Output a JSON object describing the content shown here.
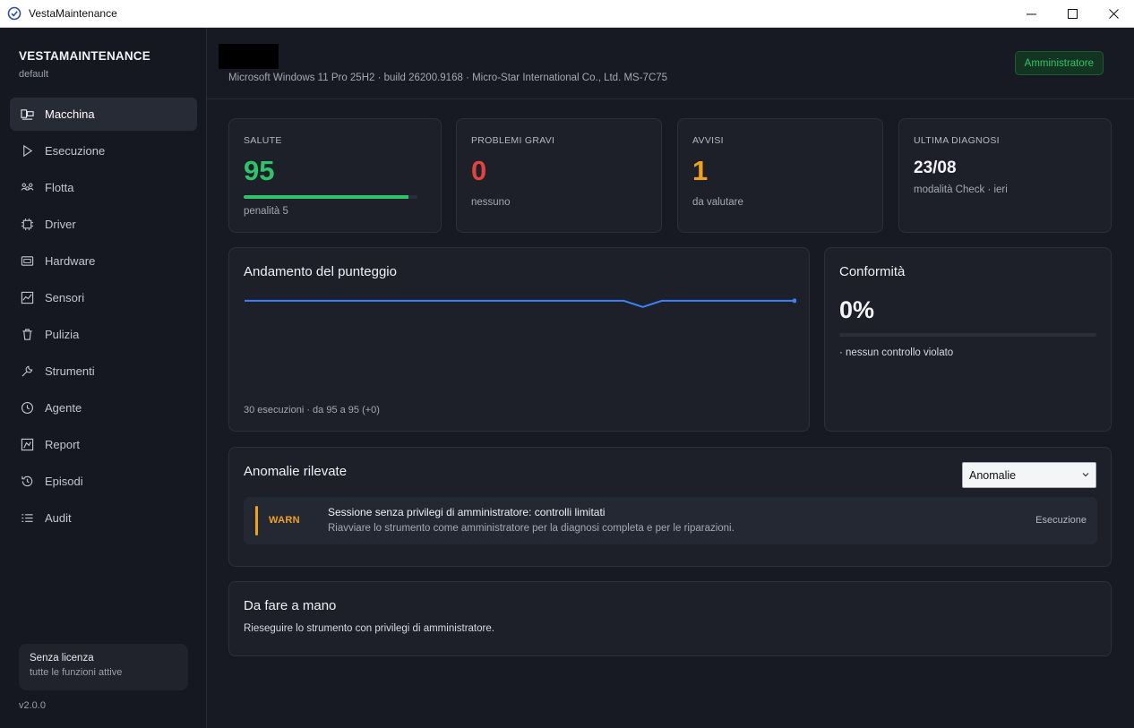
{
  "window": {
    "title": "VestaMaintenance"
  },
  "sidebar": {
    "brand": "VESTAMAINTENANCE",
    "profile": "default",
    "items": [
      {
        "label": "Macchina",
        "icon": "machine-icon"
      },
      {
        "label": "Esecuzione",
        "icon": "play-icon"
      },
      {
        "label": "Flotta",
        "icon": "fleet-icon"
      },
      {
        "label": "Driver",
        "icon": "chip-icon"
      },
      {
        "label": "Hardware",
        "icon": "hardware-icon"
      },
      {
        "label": "Sensori",
        "icon": "sensor-icon"
      },
      {
        "label": "Pulizia",
        "icon": "trash-icon"
      },
      {
        "label": "Strumenti",
        "icon": "wrench-icon"
      },
      {
        "label": "Agente",
        "icon": "clock-icon"
      },
      {
        "label": "Report",
        "icon": "report-icon"
      },
      {
        "label": "Episodi",
        "icon": "history-icon"
      },
      {
        "label": "Audit",
        "icon": "list-icon"
      }
    ],
    "license": {
      "title": "Senza licenza",
      "subtitle": "tutte le funzioni attive"
    },
    "version": "v2.0.0"
  },
  "header": {
    "sysinfo": "Microsoft Windows 11 Pro 25H2 · build 26200.9168 · Micro-Star International Co., Ltd. MS-7C75",
    "role": "Amministratore"
  },
  "stats": {
    "health": {
      "label": "SALUTE",
      "value": "95",
      "sub": "penalità 5",
      "fraction": 0.95
    },
    "critical": {
      "label": "PROBLEMI GRAVI",
      "value": "0",
      "sub": "nessuno"
    },
    "warnings": {
      "label": "AVVISI",
      "value": "1",
      "sub": "da valutare"
    },
    "last": {
      "label": "ULTIMA DIAGNOSI",
      "value": "23/08",
      "sub": "modalità Check · ieri"
    }
  },
  "trend": {
    "title": "Andamento del punteggio",
    "footer": "30 esecuzioni · da 95 a 95 (+0)"
  },
  "chart_data": {
    "type": "line",
    "title": "Andamento del punteggio",
    "x": [
      1,
      2,
      3,
      4,
      5,
      6,
      7,
      8,
      9,
      10,
      11,
      12,
      13,
      14,
      15,
      16,
      17,
      18,
      19,
      20,
      21,
      22,
      23,
      24,
      25,
      26,
      27,
      28,
      29,
      30
    ],
    "series": [
      {
        "values": [
          95,
          95,
          95,
          95,
          95,
          95,
          95,
          95,
          95,
          95,
          95,
          95,
          95,
          95,
          95,
          95,
          95,
          95,
          95,
          95,
          95,
          94,
          95,
          95,
          95,
          95,
          95,
          95,
          95,
          95
        ]
      }
    ],
    "ylim": [
      80,
      96
    ],
    "grid": false,
    "color": "#3b82f6"
  },
  "compliance": {
    "title": "Conformità",
    "value": "0%",
    "fraction": 0,
    "note": "· nessun controllo violato"
  },
  "anomalies": {
    "title": "Anomalie rilevate",
    "filter": "Anomalie",
    "items": [
      {
        "level": "WARN",
        "title": "Sessione senza privilegi di amministratore: controlli limitati",
        "description": "Riavviare lo strumento come amministratore per la diagnosi completa e per le riparazioni.",
        "category": "Esecuzione"
      }
    ]
  },
  "manual": {
    "title": "Da fare a mano",
    "text": "Rieseguire lo strumento con privilegi di amministratore."
  },
  "colors": {
    "accent": "#2fc36a",
    "danger": "#e0443e",
    "warning": "#f0a21c",
    "line": "#3b82f6"
  }
}
